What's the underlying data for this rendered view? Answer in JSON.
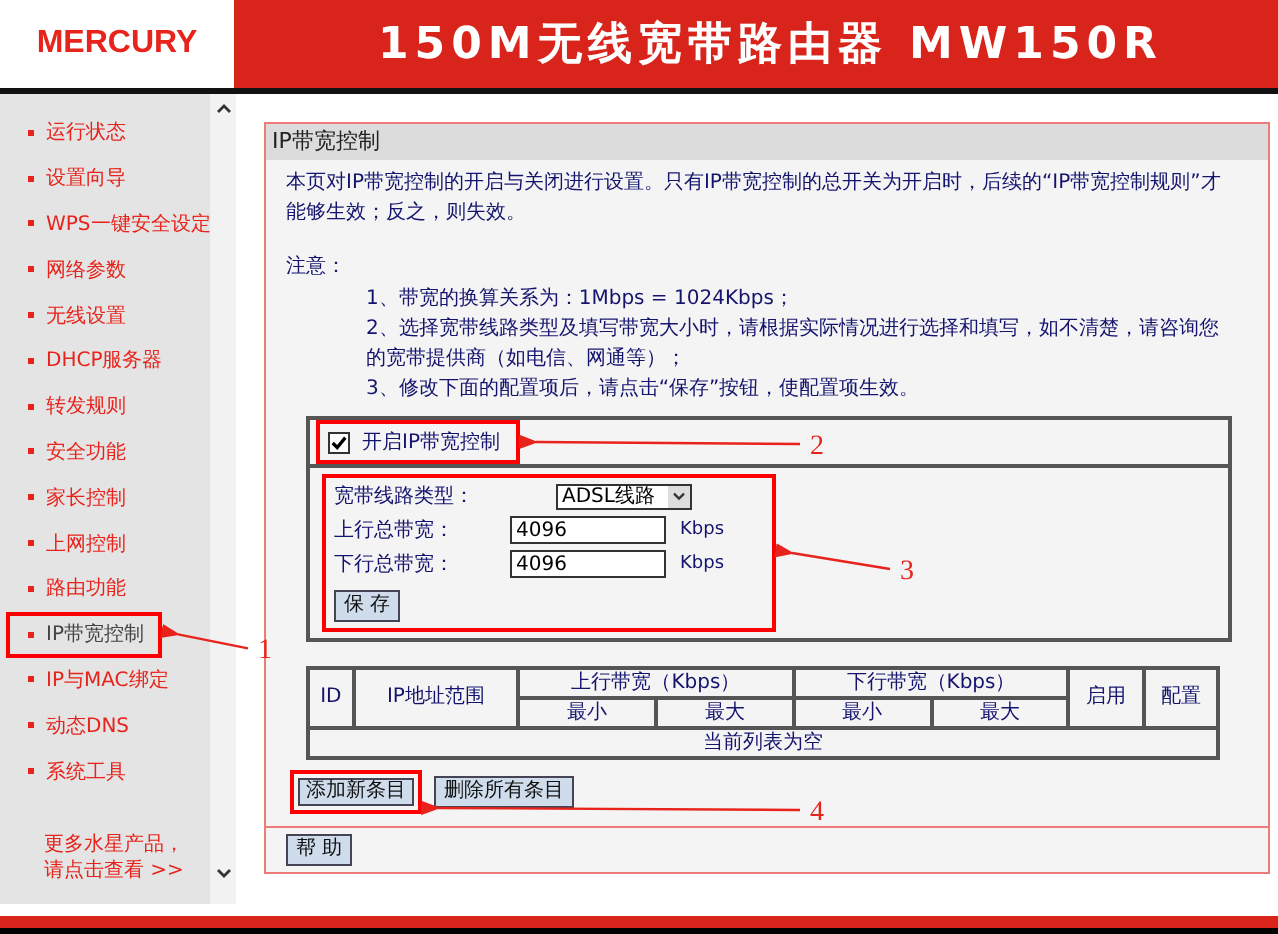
{
  "header": {
    "logo": "MERCURY",
    "title": "150M无线宽带路由器 MW150R"
  },
  "sidebar": {
    "items": [
      {
        "label": "运行状态",
        "selected": false,
        "annotated": false
      },
      {
        "label": "设置向导",
        "selected": false,
        "annotated": false
      },
      {
        "label": "WPS一键安全设定",
        "selected": false,
        "annotated": false
      },
      {
        "label": "网络参数",
        "selected": false,
        "annotated": false
      },
      {
        "label": "无线设置",
        "selected": false,
        "annotated": false
      },
      {
        "label": "DHCP服务器",
        "selected": false,
        "annotated": false
      },
      {
        "label": "转发规则",
        "selected": false,
        "annotated": false
      },
      {
        "label": "安全功能",
        "selected": false,
        "annotated": false
      },
      {
        "label": "家长控制",
        "selected": false,
        "annotated": false
      },
      {
        "label": "上网控制",
        "selected": false,
        "annotated": false
      },
      {
        "label": "路由功能",
        "selected": false,
        "annotated": false
      },
      {
        "label": "IP带宽控制",
        "selected": true,
        "annotated": true
      },
      {
        "label": "IP与MAC绑定",
        "selected": false,
        "annotated": false
      },
      {
        "label": "动态DNS",
        "selected": false,
        "annotated": false
      },
      {
        "label": "系统工具",
        "selected": false,
        "annotated": false
      }
    ],
    "footer": [
      "更多水星产品，",
      "请点击查看 >>"
    ]
  },
  "panel": {
    "title": "IP带宽控制",
    "intro": "本页对IP带宽控制的开启与关闭进行设置。只有IP带宽控制的总开关为开启时，后续的“IP带宽控制规则”才能够生效；反之，则失效。",
    "note_label": "注意：",
    "notes": [
      "1、带宽的换算关系为：1Mbps = 1024Kbps；",
      "2、选择宽带线路类型及填写带宽大小时，请根据实际情况进行选择和填写，如不清楚，请咨询您的宽带提供商（如电信、网通等）；",
      "3、修改下面的配置项后，请点击“保存”按钮，使配置项生效。"
    ],
    "enable": {
      "label": "开启IP带宽控制",
      "checked": true,
      "annotated": true
    },
    "settings": {
      "annotated": true,
      "line_type": {
        "label": "宽带线路类型：",
        "value": "ADSL线路"
      },
      "bandwidth": [
        {
          "label": "上行总带宽：",
          "value": "4096",
          "unit": "Kbps"
        },
        {
          "label": "下行总带宽：",
          "value": "4096",
          "unit": "Kbps"
        }
      ],
      "save": "保 存"
    },
    "rules_table": {
      "columns": [
        {
          "label": "ID"
        },
        {
          "label": "IP地址范围"
        },
        {
          "label": "上行带宽（Kbps）",
          "sub": [
            "最小",
            "最大"
          ]
        },
        {
          "label": "下行带宽（Kbps）",
          "sub": [
            "最小",
            "最大"
          ]
        },
        {
          "label": "启用"
        },
        {
          "label": "配置"
        }
      ],
      "empty_text": "当前列表为空"
    },
    "buttons": [
      {
        "label": "添加新条目",
        "annotated": true
      },
      {
        "label": "删除所有条目",
        "annotated": false
      }
    ],
    "help": "帮 助"
  },
  "annotations": [
    {
      "label": "1"
    },
    {
      "label": "2"
    },
    {
      "label": "3"
    },
    {
      "label": "4"
    }
  ]
}
